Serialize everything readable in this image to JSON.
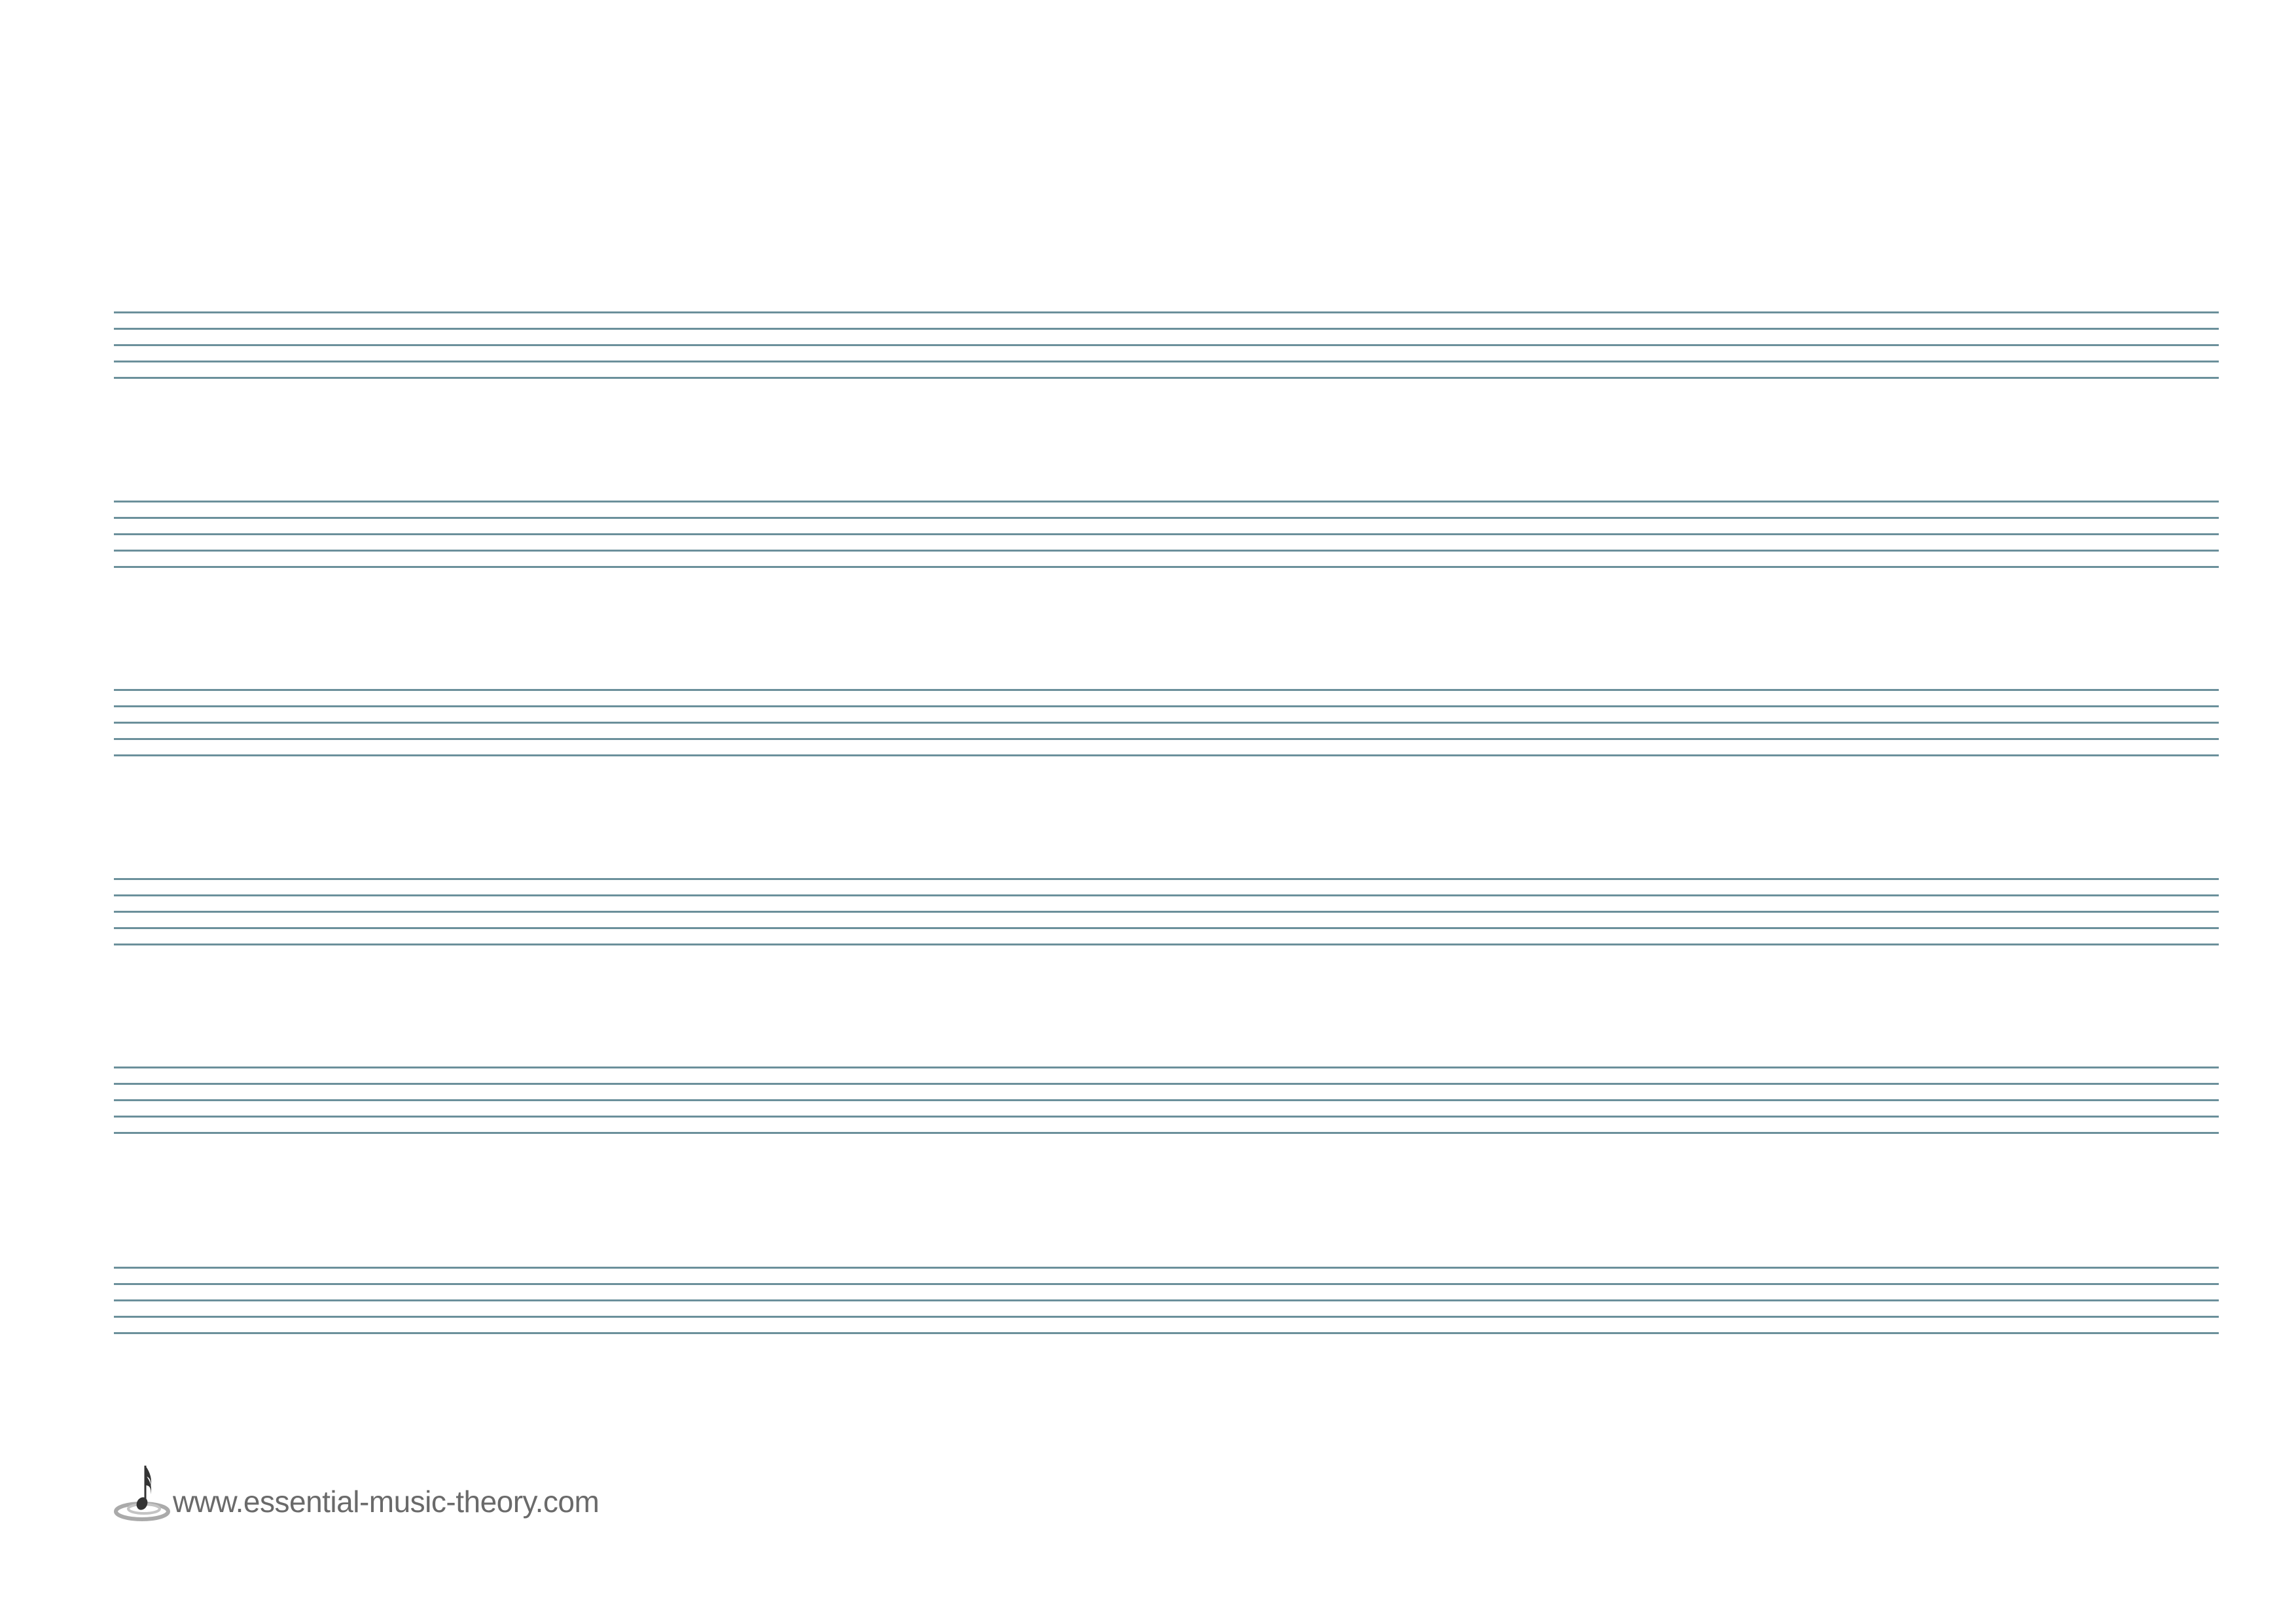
{
  "page": {
    "staff_count": 6,
    "lines_per_staff": 5,
    "line_color": "#6b909b"
  },
  "footer": {
    "url": "www.essential-music-theory.com",
    "logo_icon": "music-note-logo-icon"
  }
}
